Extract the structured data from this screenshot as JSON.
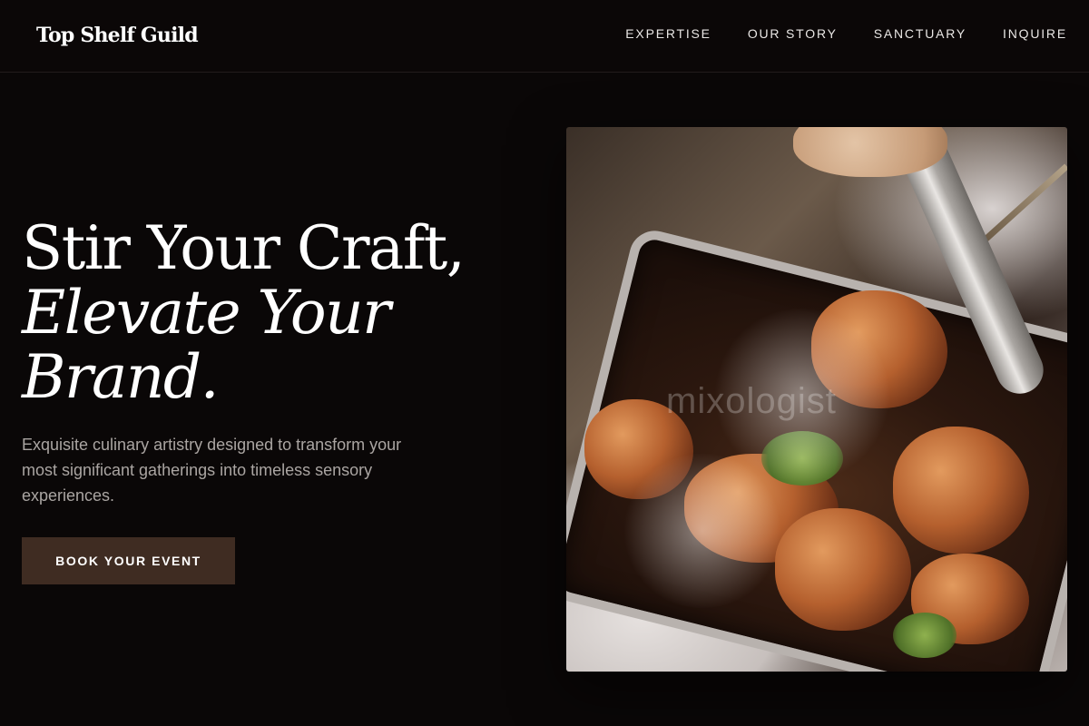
{
  "header": {
    "brand": "Top Shelf Guild",
    "nav": [
      {
        "label": "EXPERTISE"
      },
      {
        "label": "OUR STORY"
      },
      {
        "label": "SANCTUARY"
      },
      {
        "label": "INQUIRE"
      }
    ]
  },
  "hero": {
    "title_line1": "Stir Your Craft,",
    "title_line2": "Elevate Your",
    "title_line3": "Brand.",
    "subtitle": "Exquisite culinary artistry designed to transform your most significant gatherings into timeless sensory experiences.",
    "cta_label": "BOOK YOUR EVENT",
    "image": {
      "subject": "grilled-chicken-tray-with-tongs",
      "watermark": "mixologist"
    }
  },
  "colors": {
    "background": "#0a0707",
    "cta": "#3f2c22",
    "body_text": "#aaa5a2"
  }
}
